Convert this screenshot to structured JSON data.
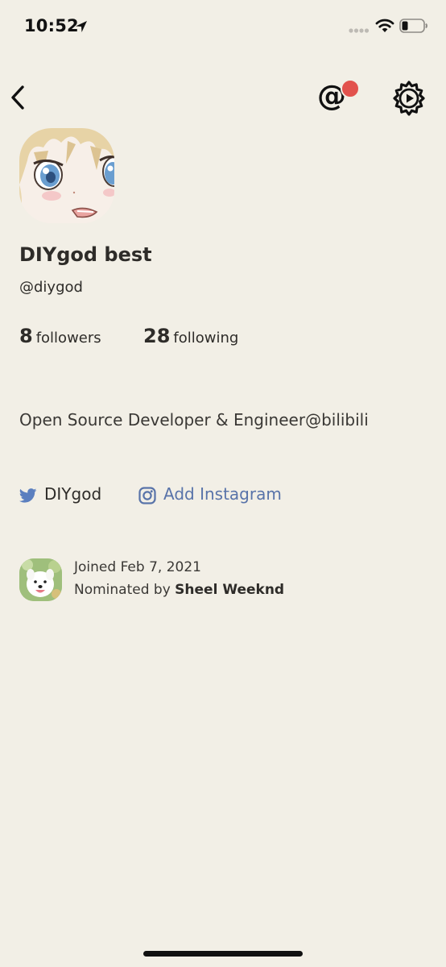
{
  "status_bar": {
    "time": "10:52",
    "icons": [
      "location-arrow-icon",
      "cellular-signal-icon",
      "wifi-icon",
      "battery-icon"
    ]
  },
  "nav": {
    "back_icon": "chevron-left-icon",
    "mention_symbol": "@",
    "mention_has_notification": true,
    "settings_icon": "gear-play-icon"
  },
  "profile": {
    "name": "DIYgod best",
    "handle": "@diygod",
    "followers_count": "8",
    "followers_label": "followers",
    "following_count": "28",
    "following_label": "following",
    "bio": "Open Source Developer & Engineer@bilibili"
  },
  "social": {
    "twitter_label": "DIYgod",
    "instagram_label": "Add Instagram"
  },
  "joined": {
    "date_text": "Joined Feb 7, 2021",
    "nominated_prefix": "Nominated by ",
    "nominator_name": "Sheel Weeknd"
  },
  "colors": {
    "background": "#f2efe6",
    "text": "#2e2c29",
    "link_blue": "#5873a9",
    "twitter_blue": "#5b7fbf",
    "notification_red": "#e2524d"
  }
}
